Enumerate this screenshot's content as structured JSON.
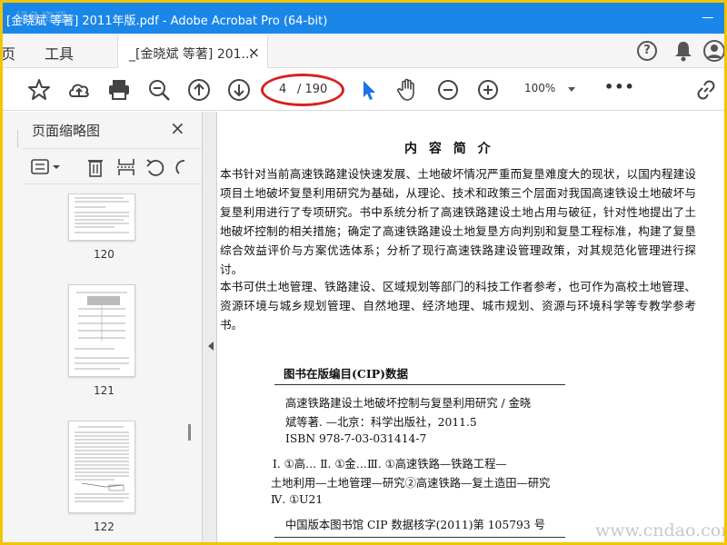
{
  "window": {
    "title": "[金晓斌 等著] 2011年版.pdf - Adobe Acrobat Pro (64-bit)"
  },
  "menu": {
    "home": "页",
    "tools": "工具"
  },
  "doc_tab": {
    "label": "_[金晓斌 等著] 201...",
    "close": "×"
  },
  "toolbar": {
    "current_page": "4",
    "total_pages": "/ 190",
    "zoom": "100%",
    "more": "•••"
  },
  "left_panel": {
    "title": "页面缩略图",
    "close": "×",
    "thumbnails": [
      {
        "page": "120"
      },
      {
        "page": "121"
      },
      {
        "page": "122"
      }
    ]
  },
  "document": {
    "heading": "内 容 简 介",
    "paragraphs": [
      "本书针对当前高速铁路建设快速发展、土地破坏情况严重而复垦难度大的现状，以国内程建设项目土地破坏复垦利用研究为基础，从理论、技术和政策三个层面对我国高速铁设土地破坏与复垦利用进行了专项研究。书中系统分析了高速铁路建设土地占用与破征，针对性地提出了土地破坏控制的相关措施；确定了高速铁路建设土地复垦方向判别和复垦工程标准，构建了复垦综合效益评价与方案优选体系；分析了现行高速铁路建设管理政策，对其规范化管理进行探讨。",
      "本书可供土地管理、铁路建设、区域规划等部门的科技工作者参考，也可作为高校土地管理、资源环境与城乡规划管理、自然地理、经济地理、城市规划、资源与环境科学等专教学参考书。"
    ],
    "cip_title": "图书在版编目(CIP)数据",
    "cip_lines": [
      "高速铁路建设土地破坏控制与复垦利用研究 / 金晓",
      "斌等著. —北京：科学出版社，2011.5",
      "ISBN 978-7-03-031414-7",
      "Ⅰ. ①高…  Ⅱ. ①金…Ⅲ. ①高速铁路—铁路工程—",
      "土地利用—土地管理—研究②高速铁路—复土造田—研究",
      "Ⅳ. ①U21",
      "中国版本图书馆 CIP 数据核字(2011)第 105793 号"
    ]
  },
  "watermarks": {
    "site": "www.cndao.com",
    "top_left": "绿色资源"
  },
  "colors": {
    "titlebar": "#1a86e8",
    "frame": "#f2c500",
    "annotation_oval": "#d9201f",
    "cursor_blue": "#1a73e8"
  }
}
